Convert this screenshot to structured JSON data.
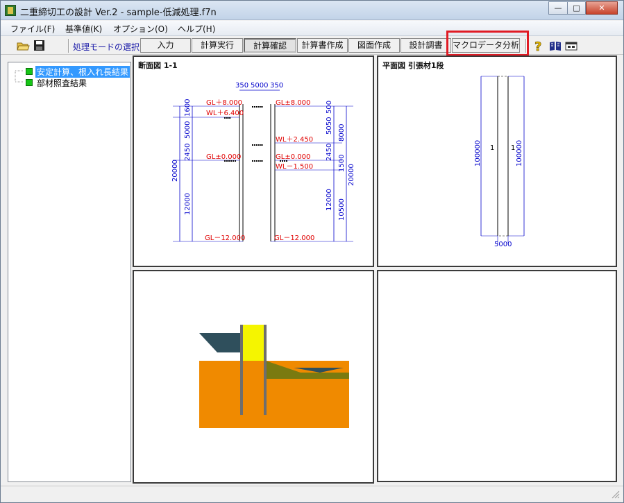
{
  "window": {
    "title": "二重締切工の設計 Ver.2 - sample-低減処理.f7n",
    "minimize": "—",
    "maximize": "□",
    "close": "✕"
  },
  "menu": {
    "items": [
      "ファイル(F)",
      "基準値(K)",
      "オプション(O)",
      "ヘルプ(H)"
    ]
  },
  "toolbar": {
    "icons": [
      "open-folder-icon",
      "save-icon",
      "help-icon",
      "book-icon",
      "window-icon"
    ],
    "mode_label": "処理モードの選択",
    "buttons": [
      "入力",
      "計算実行",
      "計算確認",
      "計算書作成",
      "図面作成",
      "設計調書",
      "マクロデータ分析"
    ],
    "active_button": "計算確認",
    "help_glyph": "?"
  },
  "tree": {
    "items": [
      {
        "label": "安定計算、根入れ長結果",
        "selected": true
      },
      {
        "label": "部材照査結果",
        "selected": false
      }
    ]
  },
  "section_view": {
    "title": "断面図 1-1",
    "top_dims": [
      "350",
      "5000",
      "350"
    ],
    "left_labels": [
      "GL＋8.000",
      "WL＋6.400",
      "GL±0.000",
      "GL－12.000"
    ],
    "right_labels": [
      "GL±8.000",
      "WL＋2.450",
      "GL±0.000",
      "WL－1.500",
      "GL－12.000"
    ],
    "left_dims": [
      "1600",
      "5000",
      "2450",
      "12000",
      "20000"
    ],
    "right_dims": [
      "5050",
      "500",
      "8000",
      "2450",
      "1500",
      "12000",
      "10500",
      "20000"
    ]
  },
  "plan_view": {
    "title": "平面図 引張材1段",
    "left_dim": "100000",
    "right_dim": "100000",
    "bottom_dim": "5000",
    "markers": [
      "1",
      "1"
    ]
  },
  "colors": {
    "ground": "#f08a00",
    "wall_fill": "#f5f500",
    "slope": "#2f4f5c",
    "olive": "#7a7a10",
    "dim_line": "#0000cc",
    "label_red": "#e00000"
  }
}
